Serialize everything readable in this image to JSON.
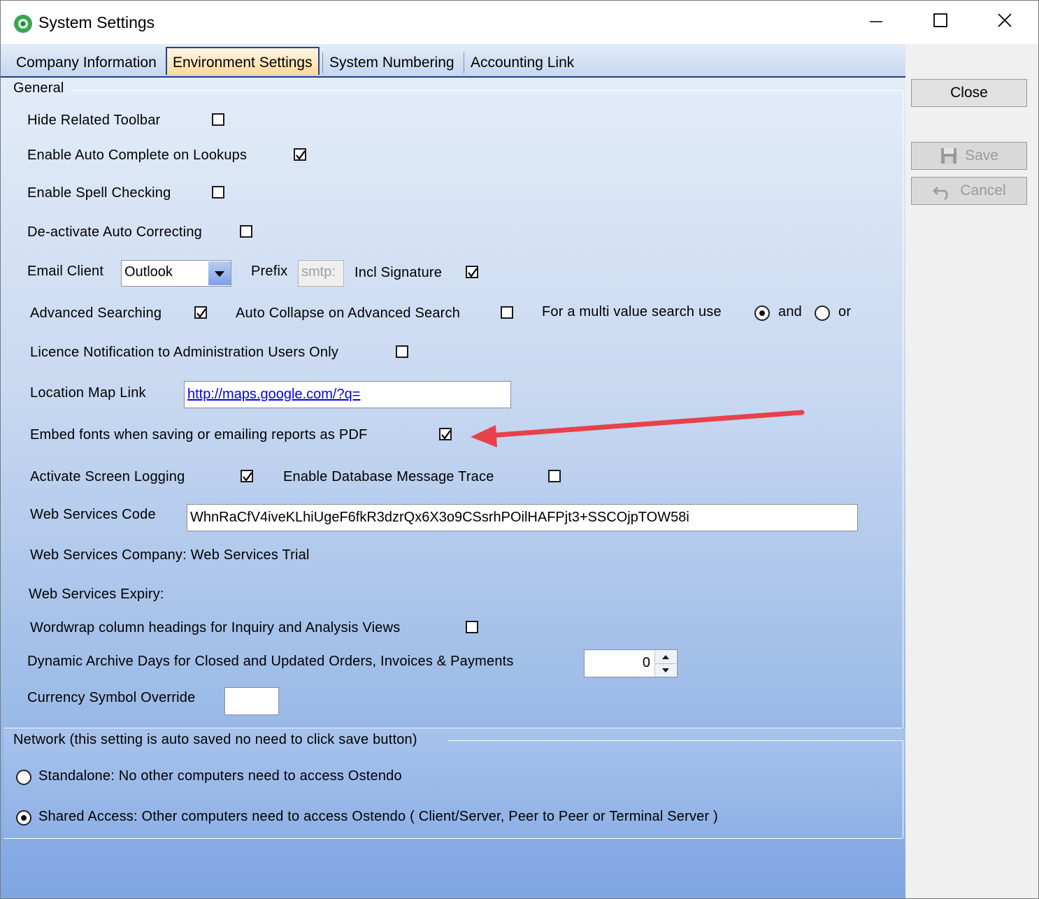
{
  "window": {
    "title": "System Settings"
  },
  "tabs": [
    {
      "label": "Company Information"
    },
    {
      "label": "Environment Settings"
    },
    {
      "label": "System Numbering"
    },
    {
      "label": "Accounting Link"
    }
  ],
  "general": {
    "group_label": "General",
    "hide_related_toolbar": {
      "label": "Hide Related Toolbar",
      "checked": false
    },
    "auto_complete": {
      "label": "Enable Auto Complete on Lookups",
      "checked": true
    },
    "spell_checking": {
      "label": "Enable Spell Checking",
      "checked": false
    },
    "auto_correcting": {
      "label": "De-activate Auto Correcting",
      "checked": false
    },
    "email_client": {
      "label": "Email Client",
      "value": "Outlook"
    },
    "prefix": {
      "label": "Prefix",
      "placeholder": "smtp:"
    },
    "incl_signature": {
      "label": "Incl Signature",
      "checked": true
    },
    "advanced_searching": {
      "label": "Advanced Searching",
      "checked": true
    },
    "auto_collapse": {
      "label": "Auto Collapse on Advanced Search",
      "checked": false
    },
    "multi_value": {
      "label": "For a multi value search use",
      "and_label": "and",
      "or_label": "or",
      "selected": "and"
    },
    "licence_notification": {
      "label": "Licence Notification to Administration Users Only",
      "checked": false
    },
    "location_map": {
      "label": "Location Map Link",
      "value": "http://maps.google.com/?q="
    },
    "embed_fonts": {
      "label": "Embed fonts when saving or emailing reports as PDF",
      "checked": true
    },
    "screen_logging": {
      "label": "Activate Screen Logging",
      "checked": true
    },
    "db_trace": {
      "label": "Enable Database Message Trace",
      "checked": false
    },
    "web_services_code": {
      "label": "Web Services Code",
      "value": "WhnRaCfV4iveKLhiUgeF6fkR3dzrQx6X3o9CSsrhPOilHAFPjt3+SSCOjpTOW58i"
    },
    "web_services_company": {
      "label": "Web Services Company: Web Services Trial"
    },
    "web_services_expiry": {
      "label": "Web Services Expiry:"
    },
    "wordwrap": {
      "label": "Wordwrap column headings for Inquiry and Analysis Views",
      "checked": false
    },
    "archive_days": {
      "label": "Dynamic Archive Days for Closed and Updated Orders, Invoices & Payments",
      "value": "0"
    },
    "currency_override": {
      "label": "Currency Symbol Override",
      "value": ""
    }
  },
  "network": {
    "group_label": "Network (this setting is auto saved no need to click save button)",
    "standalone": {
      "label": "Standalone: No other computers need to access Ostendo",
      "selected": false
    },
    "shared": {
      "label": "Shared Access: Other computers need to access Ostendo ( Client/Server, Peer to Peer or Terminal Server )",
      "selected": true
    }
  },
  "sidebar": {
    "close_label": "Close",
    "save_label": "Save",
    "cancel_label": "Cancel"
  },
  "colors": {
    "annotation_arrow": "#e8414a",
    "active_tab": "#ffd99a",
    "tab_border": "#26418f"
  }
}
